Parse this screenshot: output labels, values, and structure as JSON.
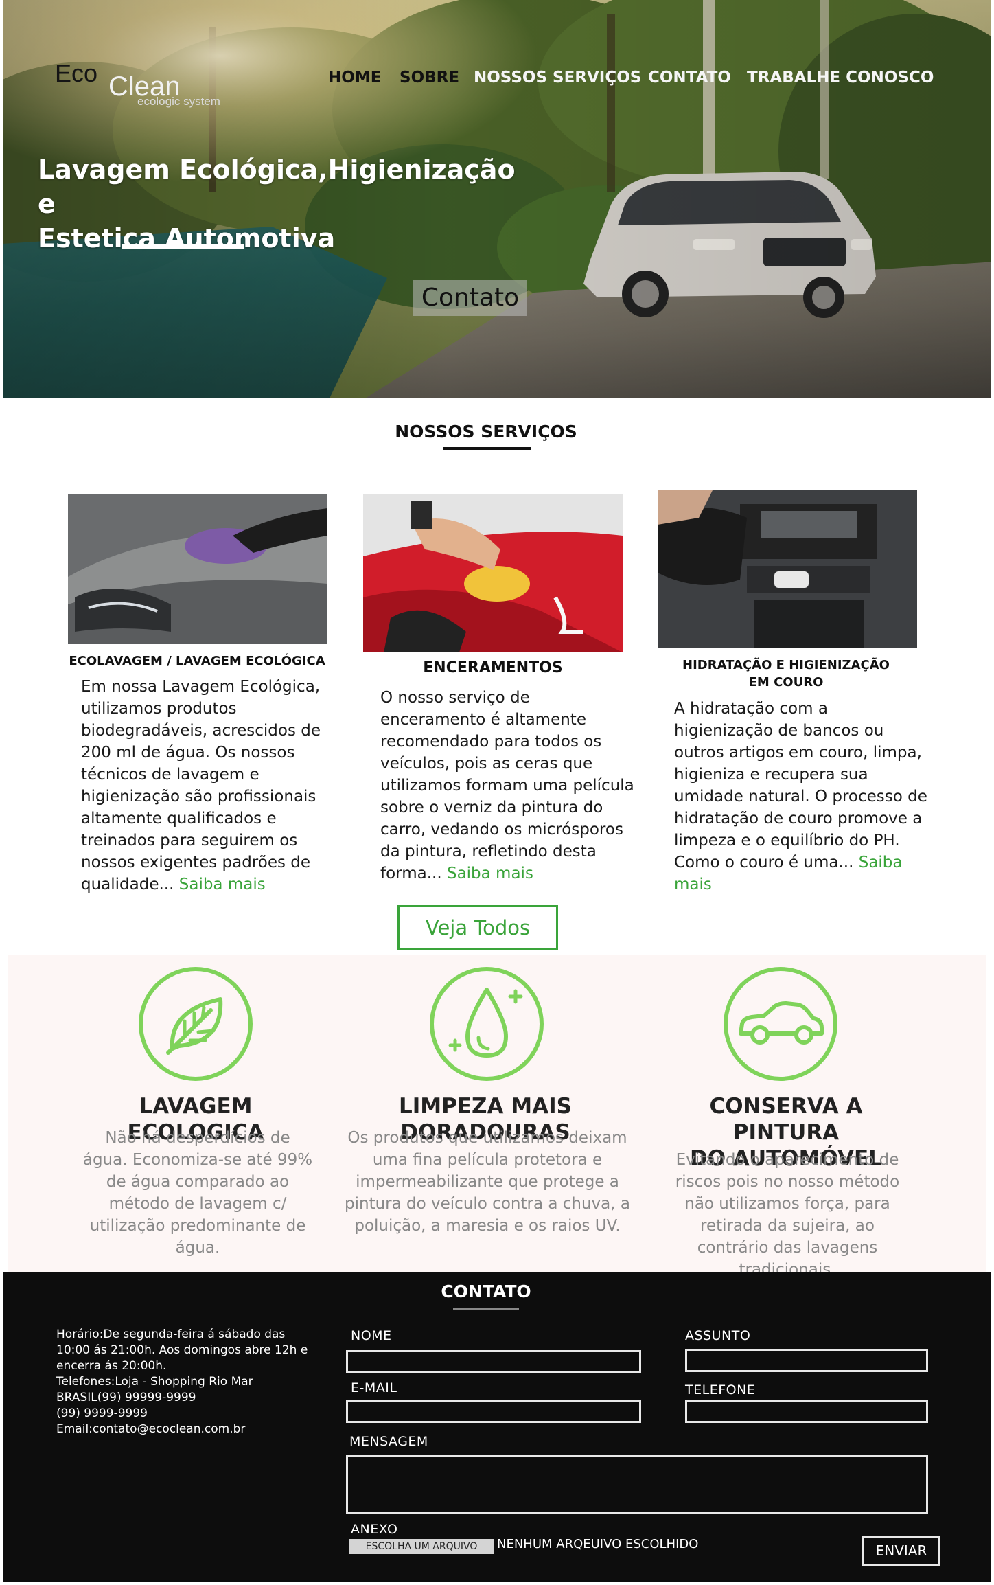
{
  "logo": {
    "eco": "Eco",
    "clean": "Clean",
    "tagline": "ecologic system"
  },
  "nav": {
    "home": "HOME",
    "sobre": "SOBRE",
    "servicos": "NOSSOS SERVIÇOS",
    "contato": "CONTATO",
    "trabalhe": "TRABALHE CONOSCO"
  },
  "hero": {
    "title_line1": "Lavagem Ecológica,Higienização e",
    "title_line2": "Estetica Automotiva",
    "contact_button": "Contato"
  },
  "services": {
    "title": "NOSSOS SERVIÇOS",
    "cards": [
      {
        "title": "ECOLAVAGEM / LAVAGEM ECOLÓGICA",
        "text": "Em nossa Lavagem Ecológica, utilizamos produtos biodegradáveis, acrescidos de 200 ml de água. Os nossos técnicos de lavagem e higienização são profissionais altamente qualificados e treinados para seguirem os nossos exigentes padrões de qualidade...",
        "more": "Saiba mais"
      },
      {
        "title": "ENCERAMENTOS",
        "text": "O nosso serviço de enceramento é altamente recomendado para todos os veículos, pois as ceras que utilizamos formam uma película sobre o verniz da pintura do carro, vedando os micrósporos da pintura, refletindo desta forma...",
        "more": "Saiba mais"
      },
      {
        "title_line1": "HIDRATAÇÃO E HIGIENIZAÇÃO",
        "title_line2": "EM COURO",
        "text": "A hidratação com a higienização de bancos ou outros artigos em couro, limpa, higieniza e recupera sua umidade natural. O processo de hidratação de couro promove a limpeza e o equilíbrio do PH. Como o couro é uma...",
        "more": "Saiba mais"
      }
    ],
    "see_all": "Veja Todos"
  },
  "features": [
    {
      "icon": "leaf-icon",
      "title": "LAVAGEM ECOLOGICA",
      "text": "Não há desperdícios de água. Economiza-se até 99% de água comparado ao método de lavagem c/ utilização predominante de água."
    },
    {
      "icon": "water-drop-icon",
      "title": "LIMPEZA MAIS DORADOURAS",
      "text": "Os produtos que utilizamos deixam uma fina película protetora e impermeabilizante que protege a pintura do veículo contra a chuva, a poluição, a maresia e os raios UV."
    },
    {
      "icon": "car-icon",
      "title_line1": "CONSERVA A PINTURA",
      "title_line2": "DO AUTOMÓVEL",
      "text": "Evitando o aparecimento de riscos pois no nosso método não utilizamos força, para retirada da sujeira, ao contrário das lavagens tradicionais."
    }
  ],
  "contact": {
    "title": "CONTATO",
    "info": [
      "Horário:De segunda-feira á sábado das",
      "10:00 ás 21:00h. Aos domingos abre 12h e",
      "encerra ás 20:00h.",
      "Telefones:Loja - Shopping Rio Mar",
      "BRASIL(99) 99999-9999",
      "(99) 9999-9999",
      "Email:contato@ecoclean.com.br"
    ],
    "labels": {
      "nome": "NOME",
      "assunto": "ASSUNTO",
      "email": "E-MAIL",
      "telefone": "TELEFONE",
      "mensagem": "MENSAGEM",
      "anexo": "ANEXO"
    },
    "file_button": "ESCOLHA UM ARQUIVO",
    "file_status": "NENHUM ARQEUIVO ESCOLHIDO",
    "send": "ENVIAR"
  },
  "colors": {
    "accent_green": "#3aa43a",
    "icon_green": "#7fd35a",
    "footer_bg": "#0d0d0d",
    "features_bg": "#fdf6f5"
  }
}
